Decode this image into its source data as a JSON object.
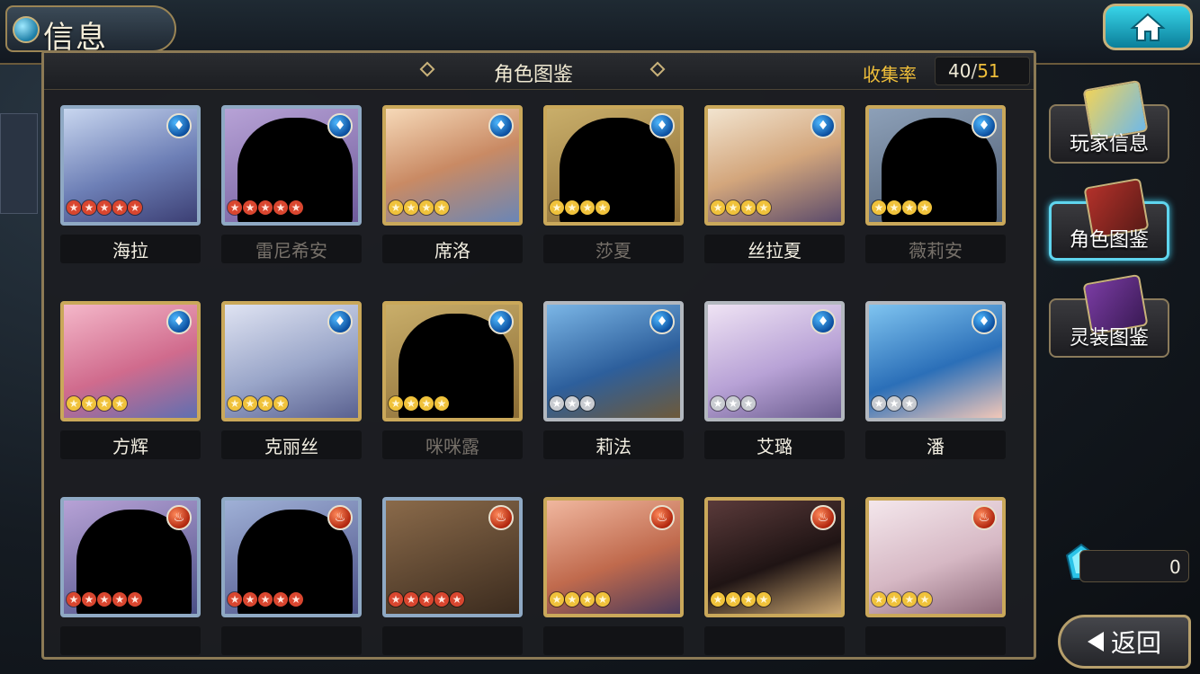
{
  "header": {
    "title": "信息"
  },
  "panel": {
    "title": "角色图鉴",
    "collect_label": "收集率",
    "collect_current": "40",
    "collect_sep": "/",
    "collect_total": "51"
  },
  "characters": [
    {
      "name": "海拉",
      "element": "water",
      "stars": 5,
      "owned": true
    },
    {
      "name": "雷尼希安",
      "element": "water",
      "stars": 5,
      "owned": false
    },
    {
      "name": "席洛",
      "element": "water",
      "stars": 4,
      "owned": true
    },
    {
      "name": "莎夏",
      "element": "water",
      "stars": 4,
      "owned": false
    },
    {
      "name": "丝拉夏",
      "element": "water",
      "stars": 4,
      "owned": true
    },
    {
      "name": "薇莉安",
      "element": "water",
      "stars": 4,
      "owned": false
    },
    {
      "name": "方辉",
      "element": "water",
      "stars": 4,
      "owned": true
    },
    {
      "name": "克丽丝",
      "element": "water",
      "stars": 4,
      "owned": true
    },
    {
      "name": "咪咪露",
      "element": "water",
      "stars": 4,
      "owned": false
    },
    {
      "name": "莉法",
      "element": "water",
      "stars": 3,
      "owned": true
    },
    {
      "name": "艾璐",
      "element": "water",
      "stars": 3,
      "owned": true
    },
    {
      "name": "潘",
      "element": "water",
      "stars": 3,
      "owned": true
    },
    {
      "name": "",
      "element": "fire",
      "stars": 5,
      "owned": false
    },
    {
      "name": "",
      "element": "fire",
      "stars": 5,
      "owned": false
    },
    {
      "name": "",
      "element": "fire",
      "stars": 5,
      "owned": true
    },
    {
      "name": "",
      "element": "fire",
      "stars": 4,
      "owned": true
    },
    {
      "name": "",
      "element": "fire",
      "stars": 4,
      "owned": true
    },
    {
      "name": "",
      "element": "fire",
      "stars": 4,
      "owned": true
    }
  ],
  "side_menu": [
    {
      "label": "玩家信息",
      "active": false
    },
    {
      "label": "角色图鉴",
      "active": true
    },
    {
      "label": "灵装图鉴",
      "active": false
    }
  ],
  "currency": {
    "value": "0"
  },
  "back_button": {
    "label": "返回"
  },
  "icons": {
    "water": "water-drop-icon",
    "fire": "fire-icon",
    "home": "home-icon"
  }
}
